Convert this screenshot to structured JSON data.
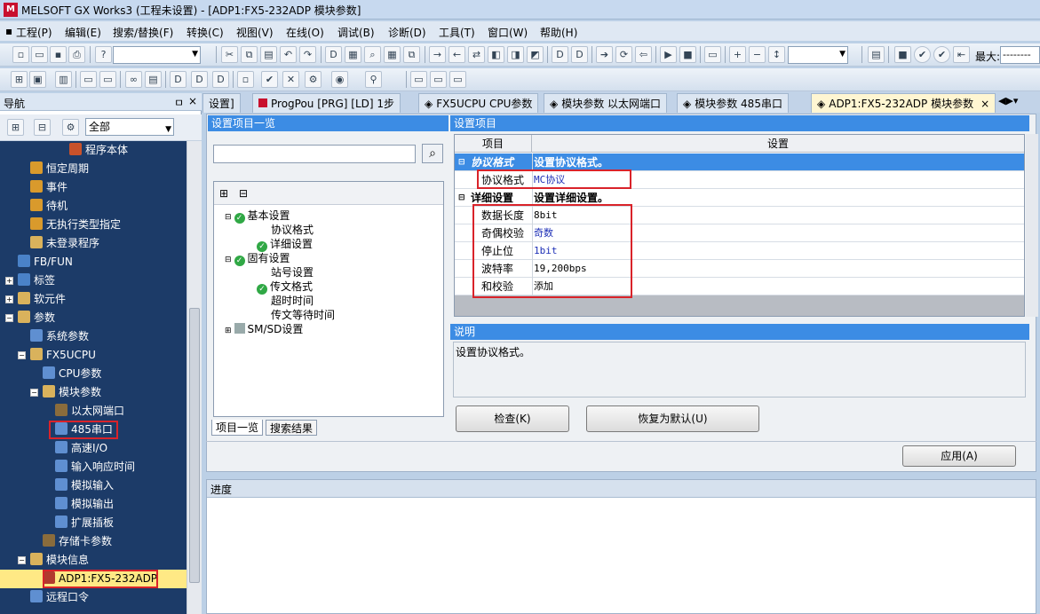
{
  "title": "MELSOFT GX Works3 (工程未设置) - [ADP1:FX5-232ADP 模块参数]",
  "menu": [
    "工程(P)",
    "编辑(E)",
    "搜索/替换(F)",
    "转换(C)",
    "视图(V)",
    "在线(O)",
    "调试(B)",
    "诊断(D)",
    "工具(T)",
    "窗口(W)",
    "帮助(H)"
  ],
  "toolbar": {
    "max_label": "最大:",
    "max_value": "--------"
  },
  "nav": {
    "title": "导航",
    "pin": "ㅁ",
    "close": "×",
    "filter": "全部",
    "items": [
      {
        "label": "程序本体"
      },
      {
        "label": "恒定周期"
      },
      {
        "label": "事件"
      },
      {
        "label": "待机"
      },
      {
        "label": "无执行类型指定"
      },
      {
        "label": "未登录程序"
      },
      {
        "label": "FB/FUN"
      },
      {
        "label": "标签"
      },
      {
        "label": "软元件"
      },
      {
        "label": "参数"
      },
      {
        "label": "系统参数"
      },
      {
        "label": "FX5UCPU"
      },
      {
        "label": "CPU参数"
      },
      {
        "label": "模块参数"
      },
      {
        "label": "以太网端口"
      },
      {
        "label": "485串口"
      },
      {
        "label": "高速I/O"
      },
      {
        "label": "输入响应时间"
      },
      {
        "label": "模拟输入"
      },
      {
        "label": "模拟输出"
      },
      {
        "label": "扩展插板"
      },
      {
        "label": "存储卡参数"
      },
      {
        "label": "模块信息"
      },
      {
        "label": "ADP1:FX5-232ADP"
      },
      {
        "label": "远程口令"
      }
    ]
  },
  "tabs": [
    "设置]",
    "ProgPou [PRG] [LD] 1步",
    "FX5UCPU CPU参数",
    "模块参数 以太网端口",
    "模块参数 485串口",
    "ADP1:FX5-232ADP 模块参数"
  ],
  "left_panel": {
    "header": "设置项目一览",
    "search_value": "",
    "tree": [
      "基本设置",
      "协议格式",
      "详细设置",
      "固有设置",
      "站号设置",
      "传文格式",
      "超时时间",
      "传文等待时间",
      "SM/SD设置"
    ],
    "tab_list": "项目一览",
    "tab_search": "搜索结果"
  },
  "right_panel": {
    "header": "设置项目",
    "col_item": "项目",
    "col_setting": "设置",
    "section1": {
      "label": "协议格式",
      "value": "设置协议格式。"
    },
    "row_protocol": {
      "label": "协议格式",
      "value": "MC协议"
    },
    "section2": {
      "label": "详细设置",
      "value": "设置详细设置。"
    },
    "rows": [
      {
        "label": "数据长度",
        "value": "8bit",
        "color": "#000000"
      },
      {
        "label": "奇偶校验",
        "value": "奇数",
        "color": "#1d2fb6"
      },
      {
        "label": "停止位",
        "value": "1bit",
        "color": "#1d2fb6"
      },
      {
        "label": "波特率",
        "value": "19,200bps",
        "color": "#000000"
      },
      {
        "label": "和校验",
        "value": "添加",
        "color": "#000000"
      }
    ]
  },
  "description": {
    "header": "说明",
    "text": "设置协议格式。"
  },
  "buttons": {
    "check": "检查(K)",
    "restore": "恢复为默认(U)",
    "apply": "应用(A)"
  },
  "progress": {
    "header": "进度"
  },
  "colors": {
    "accent": "#3c8ce4",
    "highlight_box": "#d9232a",
    "tree_bg": "#1c3b68"
  }
}
